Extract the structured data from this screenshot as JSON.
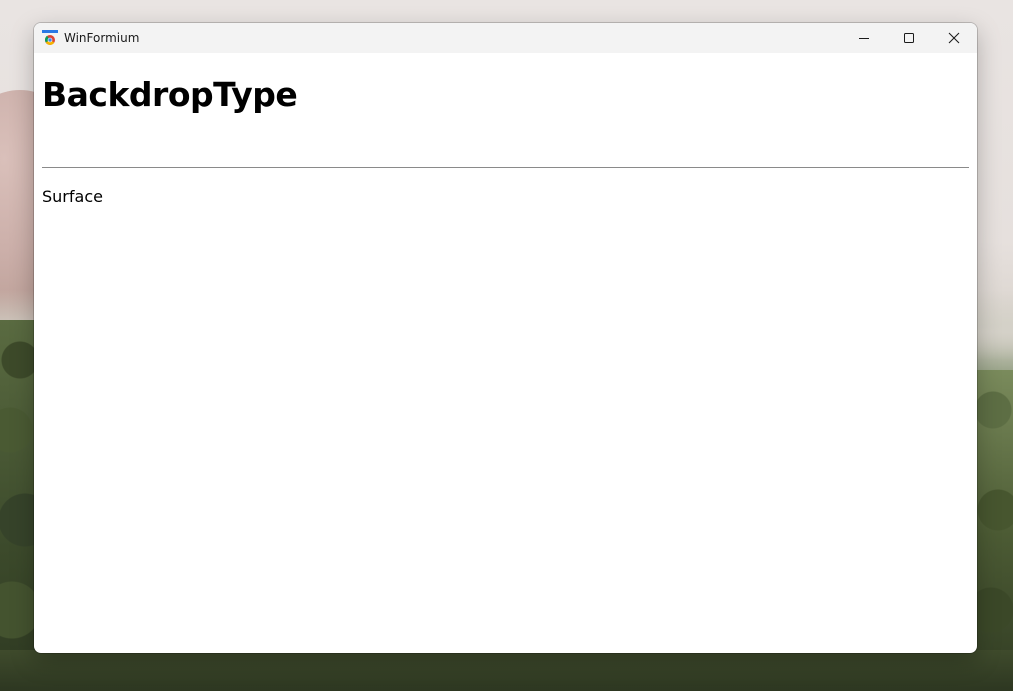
{
  "window": {
    "title": "WinFormium",
    "icon": "chromium-app-icon"
  },
  "caption_buttons": {
    "minimize": "minimize-icon",
    "maximize": "maximize-icon",
    "close": "close-icon"
  },
  "page": {
    "heading": "BackdropType",
    "value": "Surface"
  },
  "colors": {
    "titlebar_bg": "#f3f3f3",
    "content_bg": "#ffffff",
    "rule": "#8a8a8a"
  }
}
